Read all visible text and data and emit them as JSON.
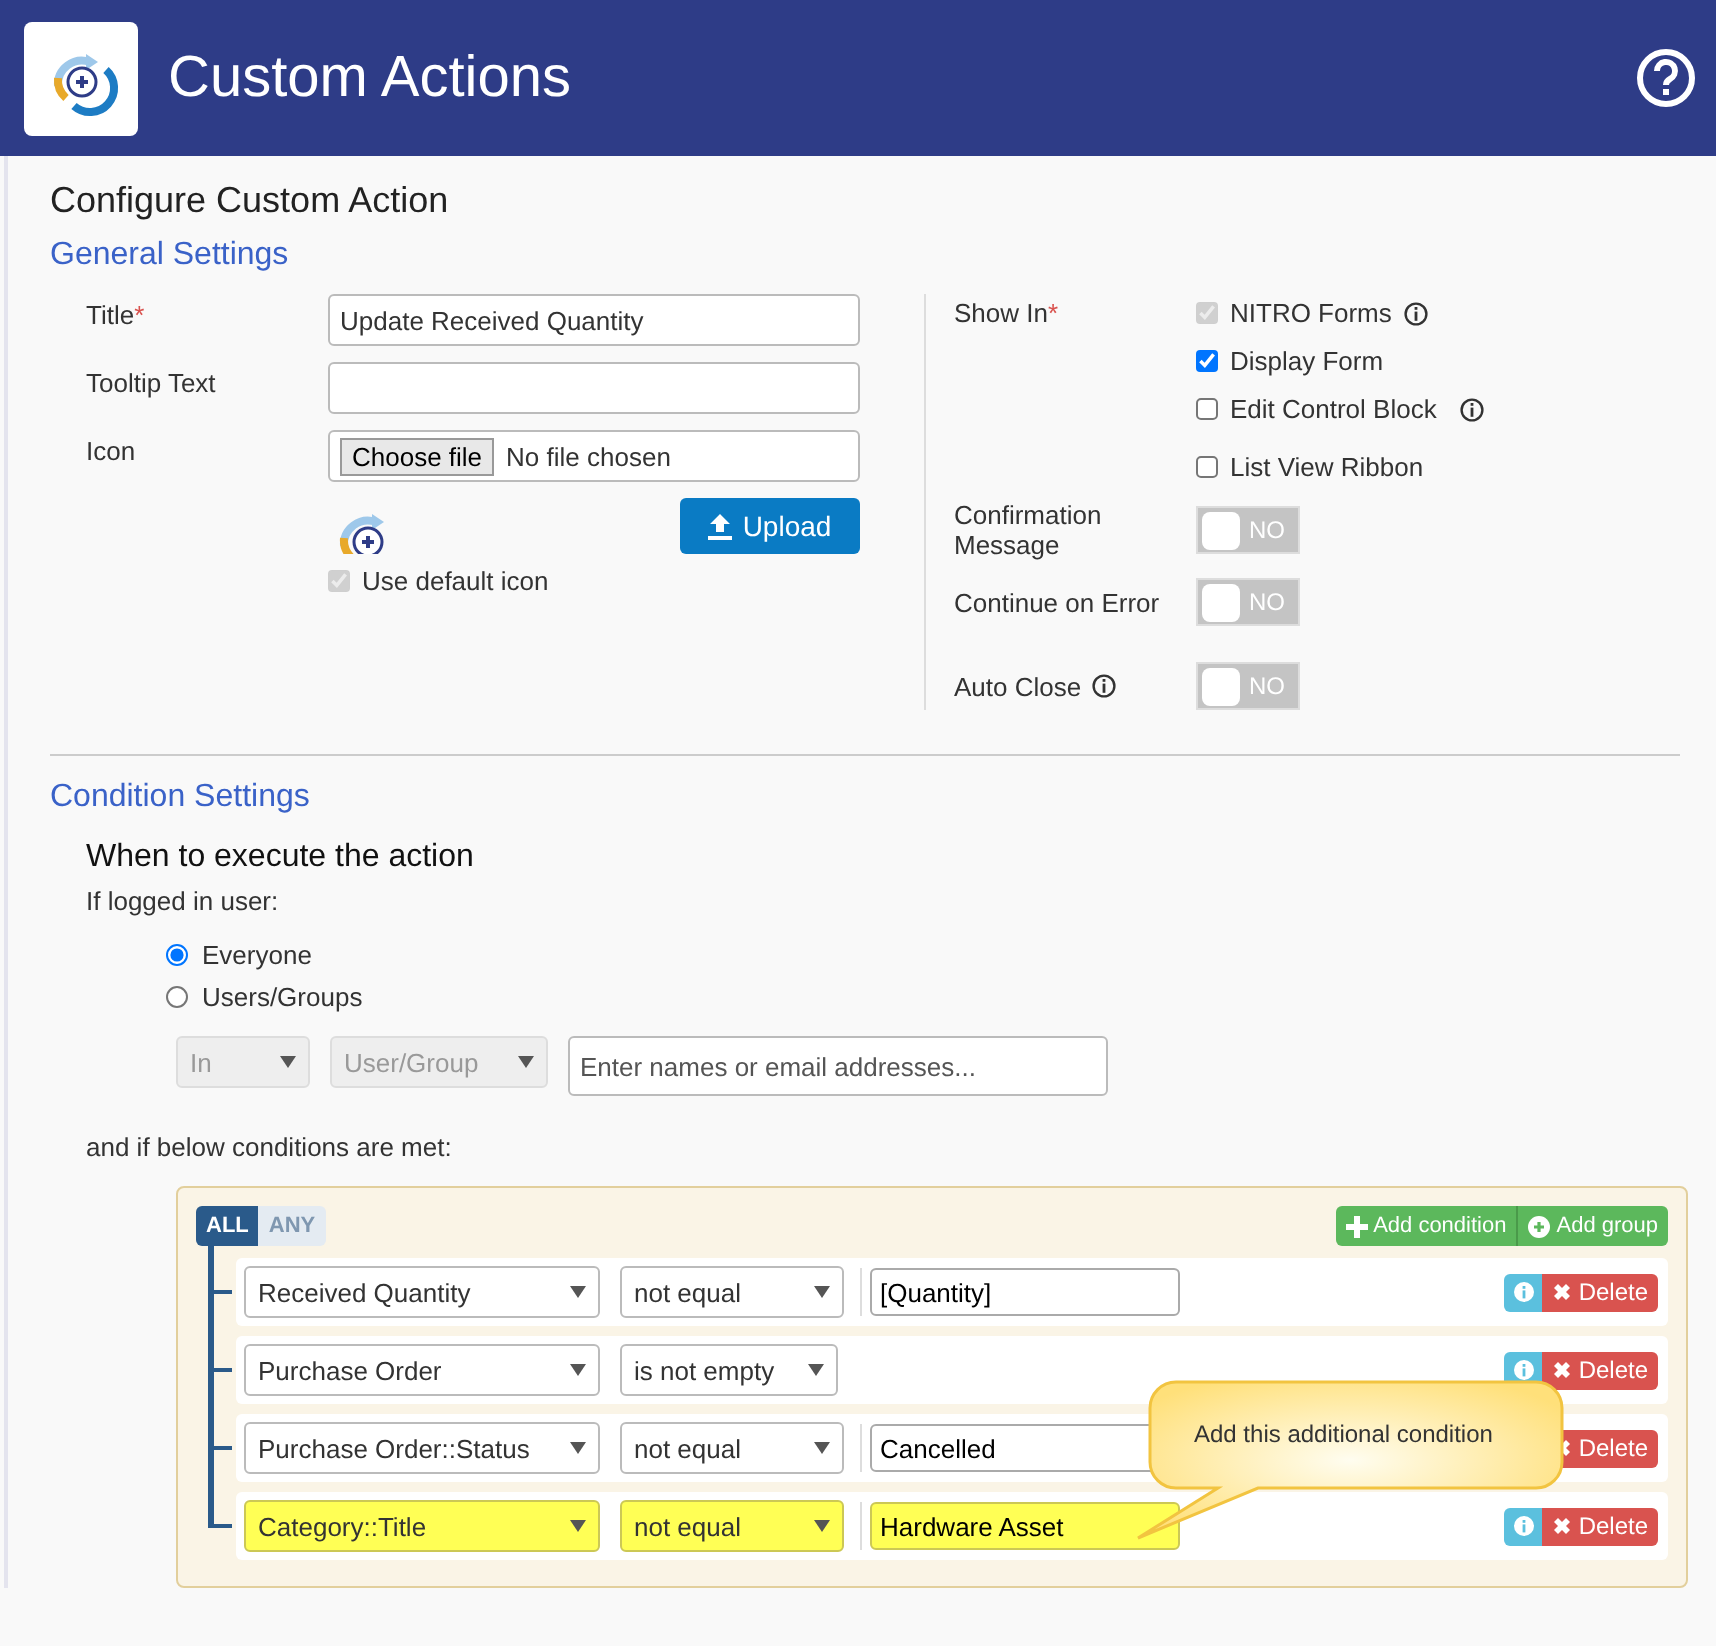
{
  "header": {
    "title": "Custom Actions"
  },
  "page_title": "Configure Custom Action",
  "general_settings": {
    "heading": "General Settings",
    "fields": [
      {
        "kind": "text",
        "label": "Title",
        "required_mark": "*",
        "value": "Update Received Quantity"
      },
      {
        "kind": "text",
        "label": "Tooltip Text"
      },
      {
        "kind": "file",
        "label": "Icon",
        "button": "Choose file",
        "status": "No file chosen"
      }
    ],
    "upload_button": "Upload",
    "use_default_icon": {
      "label": "Use default icon",
      "checked": true,
      "disabled": true
    }
  },
  "show_in": {
    "label": "Show In",
    "required_mark": "*",
    "options": [
      {
        "label": "NITRO Forms",
        "checked": true,
        "disabled": true,
        "info": true
      },
      {
        "label": "Display Form",
        "checked": true,
        "disabled": false,
        "info": false
      },
      {
        "label": "Edit Control Block",
        "checked": false,
        "disabled": false,
        "info": true
      },
      {
        "label": "List View Ribbon",
        "checked": false,
        "disabled": false,
        "info": false
      }
    ]
  },
  "toggles": [
    {
      "label": "Confirmation Message",
      "info": false,
      "on": false,
      "text": "NO"
    },
    {
      "label": "Continue on Error",
      "info": false,
      "on": false,
      "text": "NO"
    },
    {
      "label": "Auto Close",
      "info": true,
      "on": false,
      "text": "NO"
    }
  ],
  "condition_settings": {
    "heading": "Condition Settings",
    "subheading": "When to execute the action",
    "user_label": "If logged in user:",
    "radios": [
      {
        "label": "Everyone",
        "selected": true
      },
      {
        "label": "Users/Groups",
        "selected": false
      }
    ],
    "user_filter": {
      "operator": "In",
      "type": "User/Group",
      "placeholder": "Enter names or email addresses..."
    },
    "conditions_label": "and if below conditions are met:",
    "group": {
      "modes": [
        {
          "label": "ALL",
          "selected": true
        },
        {
          "label": "ANY",
          "selected": false
        }
      ],
      "add_condition": "Add condition",
      "add_group": "Add group",
      "rules": [
        {
          "field": "Received Quantity",
          "operator": "not equal",
          "value": "[Quantity]",
          "highlighted": false,
          "info_button": true,
          "delete": "Delete"
        },
        {
          "field": "Purchase Order",
          "operator": "is not empty",
          "highlighted": false,
          "info_button": true,
          "delete": "Delete"
        },
        {
          "field": "Purchase Order::Status",
          "operator": "not equal",
          "value": "Cancelled",
          "highlighted": false,
          "info_button": false,
          "delete": "Delete"
        },
        {
          "field": "Category::Title",
          "operator": "not equal",
          "value": "Hardware Asset",
          "highlighted": true,
          "info_button": true,
          "delete": "Delete"
        }
      ]
    },
    "callout": {
      "text": "Add this additional condition"
    }
  }
}
